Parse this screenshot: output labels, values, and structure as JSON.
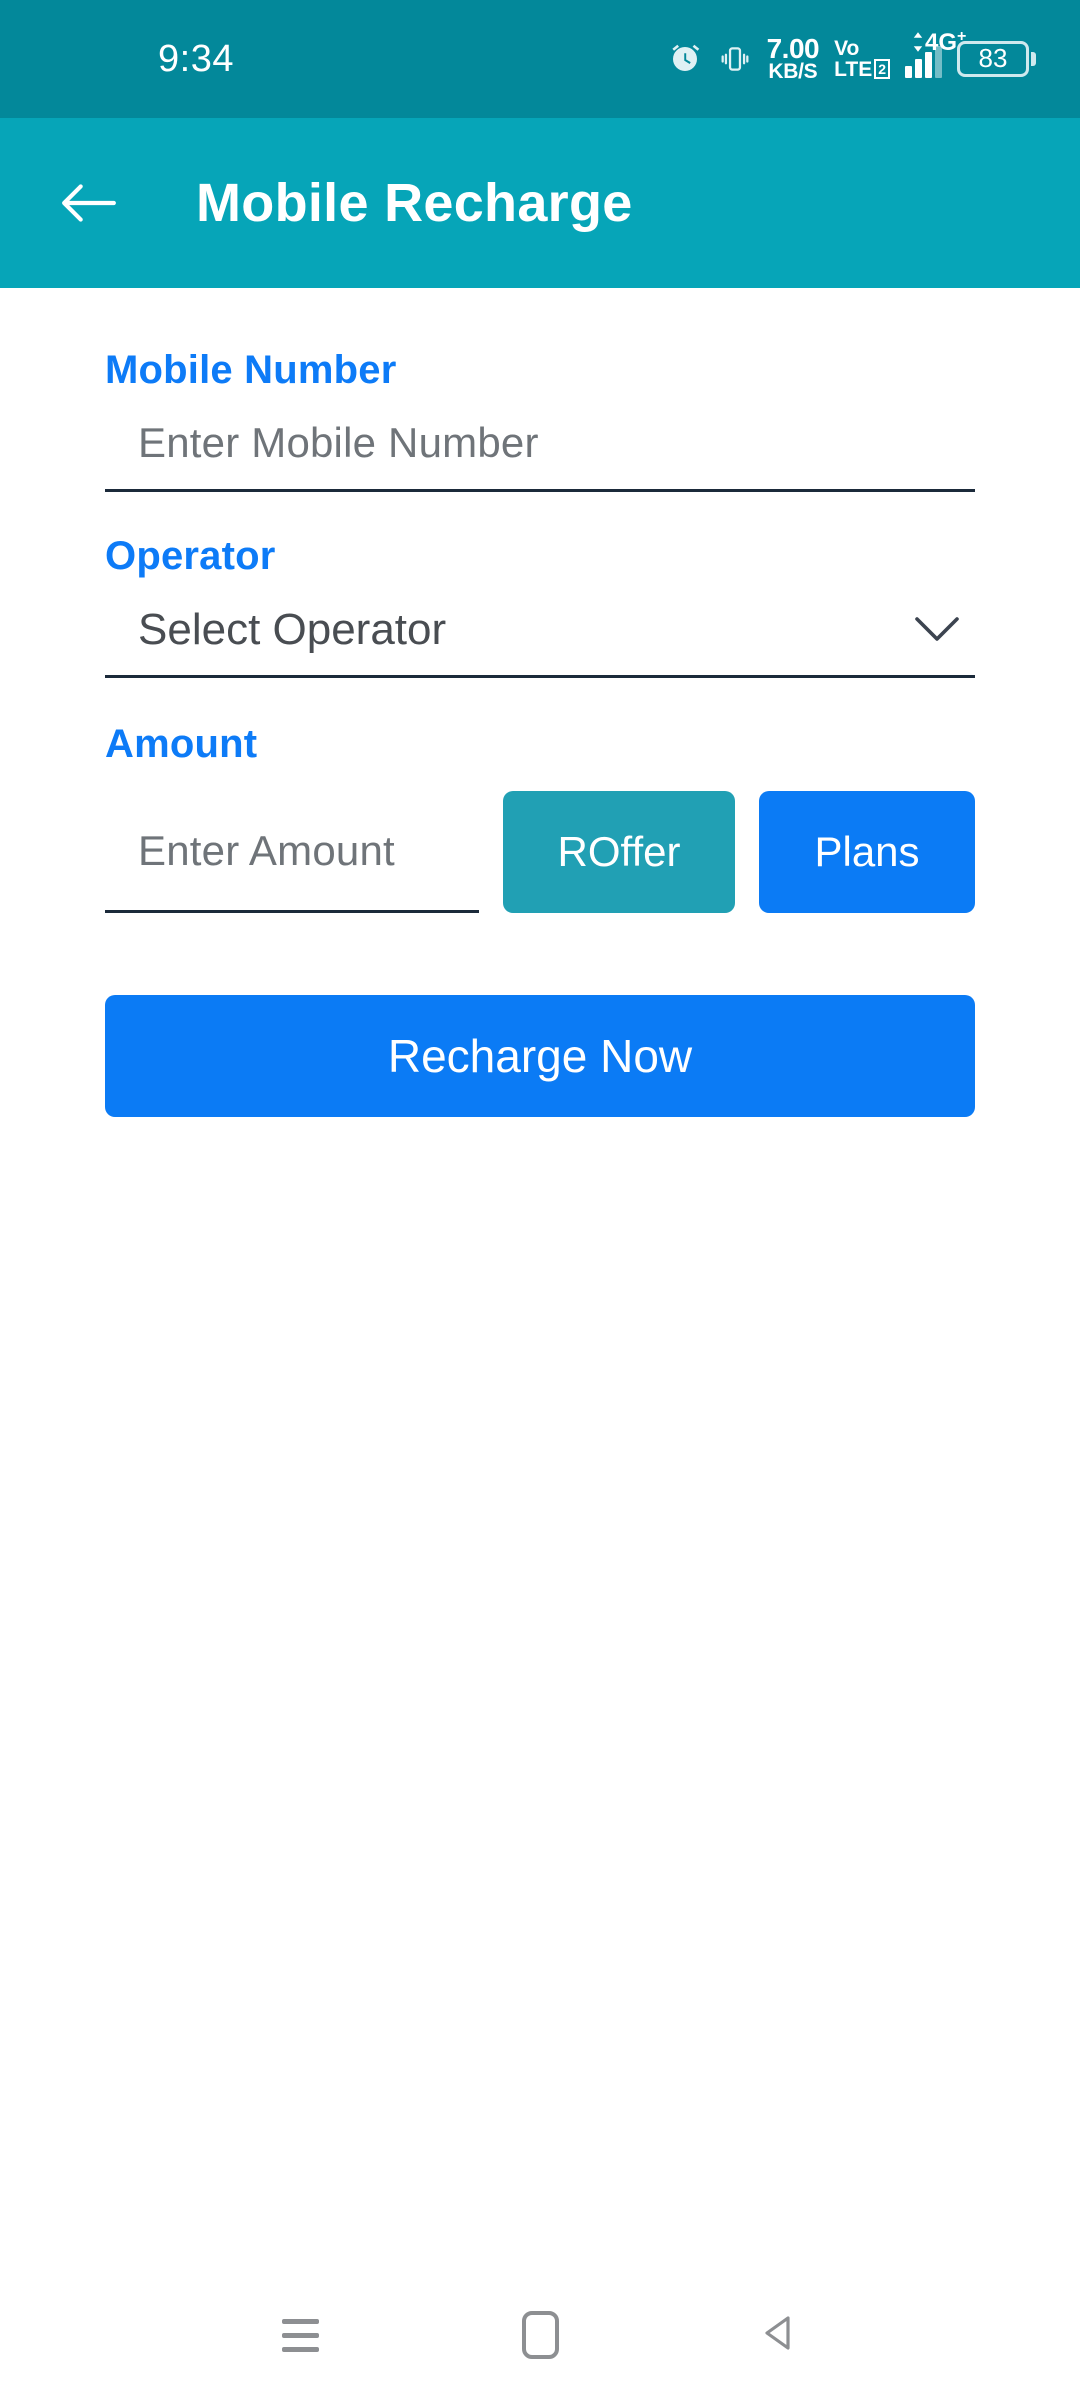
{
  "status_bar": {
    "time": "9:34",
    "alarm_icon": "alarm-clock-icon",
    "vibrate_icon": "vibrate-icon",
    "network_speed_value": "7.00",
    "network_speed_unit": "KB/S",
    "volte_line1": "Vo",
    "volte_line2": "LTE",
    "sim_number": "2",
    "network_type": "4G",
    "network_type_sup": "+",
    "battery_level": "83",
    "background_color": "#03889A"
  },
  "app_bar": {
    "back_icon": "back-arrow-icon",
    "title": "Mobile Recharge",
    "background_color": "#06A5B8"
  },
  "form": {
    "mobile_number": {
      "label": "Mobile Number",
      "placeholder": "Enter Mobile Number",
      "value": ""
    },
    "operator": {
      "label": "Operator",
      "selected": "Select Operator",
      "dropdown_icon": "chevron-down-icon"
    },
    "amount": {
      "label": "Amount",
      "placeholder": "Enter Amount",
      "value": "",
      "roffer_button": "ROffer",
      "plans_button": "Plans"
    },
    "submit_button": "Recharge Now",
    "label_color": "#0D7BF7",
    "primary_color": "#0B7BF5",
    "accent_color": "#21A0B4"
  },
  "nav_bar": {
    "recents": "recents-icon",
    "home": "home-icon",
    "back": "back-icon"
  }
}
